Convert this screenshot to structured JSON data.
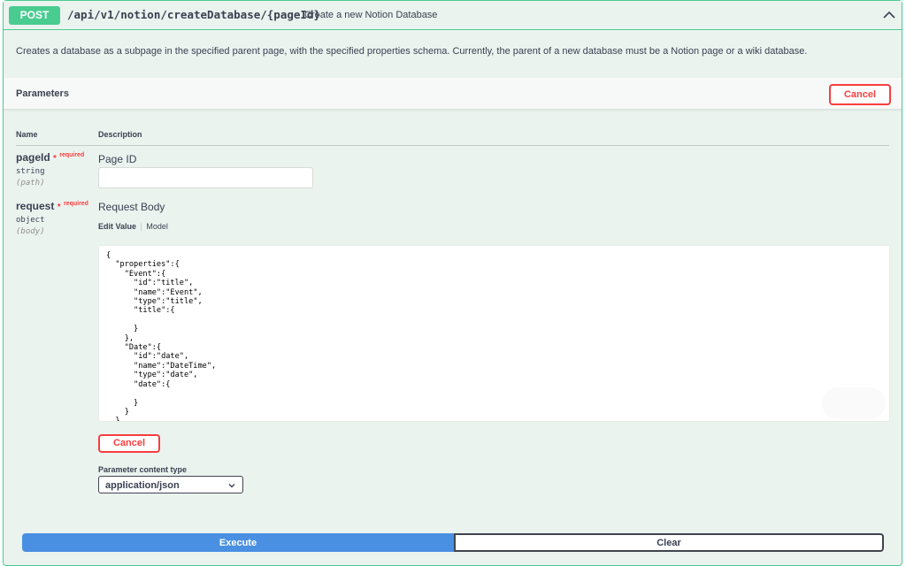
{
  "operation": {
    "method": "POST",
    "path": "/api/v1/notion/createDatabase/{pageId}",
    "summary": "Create a new Notion Database",
    "description": "Creates a database as a subpage in the specified parent page, with the specified properties schema. Currently, the parent of a new database must be a Notion page or a wiki database."
  },
  "parameters_section": {
    "title": "Parameters",
    "cancel_label": "Cancel",
    "col_name": "Name",
    "col_description": "Description"
  },
  "params": [
    {
      "name": "pageId",
      "required_star": "*",
      "required_label": "required",
      "type": "string",
      "location": "(path)",
      "description": "Page ID",
      "value": ""
    },
    {
      "name": "request",
      "required_star": "*",
      "required_label": "required",
      "type": "object",
      "location": "(body)",
      "description": "Request Body",
      "tab_edit": "Edit Value",
      "tab_sep": "|",
      "tab_model": "Model",
      "body_text": "{\n  \"properties\":{\n    \"Event\":{\n      \"id\":\"title\",\n      \"name\":\"Event\",\n      \"type\":\"title\",\n      \"title\":{\n\n      }\n    },\n    \"Date\":{\n      \"id\":\"date\",\n      \"name\":\"DateTime\",\n      \"type\":\"date\",\n      \"date\":{\n\n      }\n    }\n  },\n  \"title\":[\n    {"
    }
  ],
  "body_cancel_label": "Cancel",
  "content_type": {
    "label": "Parameter content type",
    "selected": "application/json"
  },
  "actions": {
    "execute_label": "Execute",
    "clear_label": "Clear"
  },
  "colors": {
    "post_green": "#49cc90",
    "block_bg": "#ebf3ef",
    "cancel_red": "#f93e3e",
    "execute_blue": "#4990e2"
  },
  "icons": {
    "collapse": "chevron-up-icon",
    "select": "chevron-down-icon"
  }
}
